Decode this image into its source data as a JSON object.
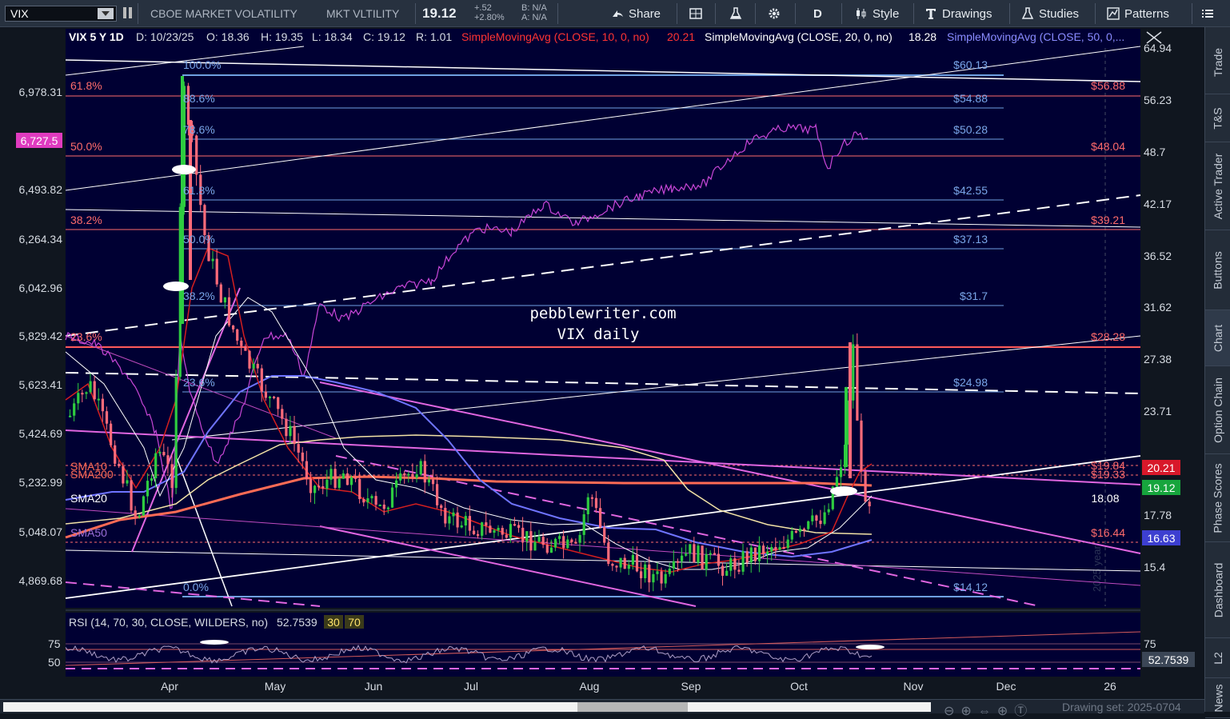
{
  "toolbar": {
    "symbol": "VIX",
    "description": "CBOE MARKET VOLATILITY",
    "short_desc": "MKT VLTILITY",
    "last": "19.12",
    "change": "+.52",
    "change_pct": "+2.80%",
    "bid": "B: N/A",
    "ask": "A: N/A",
    "share": "Share",
    "period": "D",
    "style": "Style",
    "drawings": "Drawings",
    "studies": "Studies",
    "patterns": "Patterns"
  },
  "header": {
    "title": "VIX 5 Y 1D",
    "date": "D: 10/23/25",
    "open": "O: 18.36",
    "high": "H: 19.35",
    "low": "L: 18.34",
    "close": "C: 19.12",
    "range": "R: 1.01",
    "sma10": "SimpleMovingAvg (CLOSE, 10, 0, no)",
    "sma10_val": "20.21",
    "sma20": "SimpleMovingAvg (CLOSE, 20, 0, no)",
    "sma20_val": "18.28",
    "sma50": "SimpleMovingAvg (CLOSE, 50, 0,..."
  },
  "annotation": {
    "line1": "pebblewriter.com",
    "line2": "VIX daily"
  },
  "fib_left": [
    "100.0%",
    "88.6%",
    "78.6%",
    "61.8%",
    "50.0%",
    "38.2%",
    "23.6%",
    "0.0%"
  ],
  "fib_left_red": [
    "61.8%",
    "50.0%",
    "38.2%",
    "23.6%"
  ],
  "fib_right_blue": [
    "$60.13",
    "$54.88",
    "$50.28",
    "$42.55",
    "$37.13",
    "$31.7",
    "$24.98",
    "$14.12"
  ],
  "fib_right_red": [
    "$56.88",
    "$48.04",
    "$39.21",
    "$28.28",
    "$19.84",
    "$19.33",
    "$16.44"
  ],
  "right_axis": [
    "64.94",
    "56.23",
    "48.7",
    "42.17",
    "36.52",
    "31.62",
    "27.38",
    "23.71",
    "17.78",
    "15.4"
  ],
  "left_axis": [
    "6,978.31",
    "6,727.5",
    "6,493.82",
    "6,264.34",
    "6,042.96",
    "5,829.42",
    "5,623.41",
    "5,424.69",
    "5,232.99",
    "5,048.07",
    "4,869.68"
  ],
  "price_tags": {
    "sma10": "20.21",
    "last": "19.12",
    "sma20": "18.08",
    "sma50": "16.63",
    "spx": "6,727.5"
  },
  "ma_labels": [
    "SMA10",
    "SMA200",
    "SMA20",
    "SMA50"
  ],
  "months": [
    "Apr",
    "May",
    "Jun",
    "Jul",
    "Aug",
    "Sep",
    "Oct",
    "Nov",
    "Dec",
    "26"
  ],
  "year_watermark": "2025 year",
  "rsi": {
    "label": "RSI (14, 70, 30, CLOSE, WILDERS, no)",
    "value": "52.7539",
    "ob": "30",
    "os": "70",
    "axis": [
      "75",
      "50"
    ],
    "right_top": "75",
    "right_val": "52.7539"
  },
  "side_tabs": [
    "Trade",
    "T&S",
    "Active Trader",
    "Buttons",
    "Chart",
    "Option Chain",
    "Phase Scores",
    "Dashboard",
    "L2",
    "News"
  ],
  "drawing_set": "Drawing set: 2025-0704",
  "colors": {
    "bg": "#000033",
    "fib_blue": "#7aa6e8",
    "fib_red": "#ff6b6b",
    "magenta": "#e066e0",
    "sma10": "#ff3333",
    "sma20": "#ffffff",
    "sma50": "#6f74ff"
  }
}
